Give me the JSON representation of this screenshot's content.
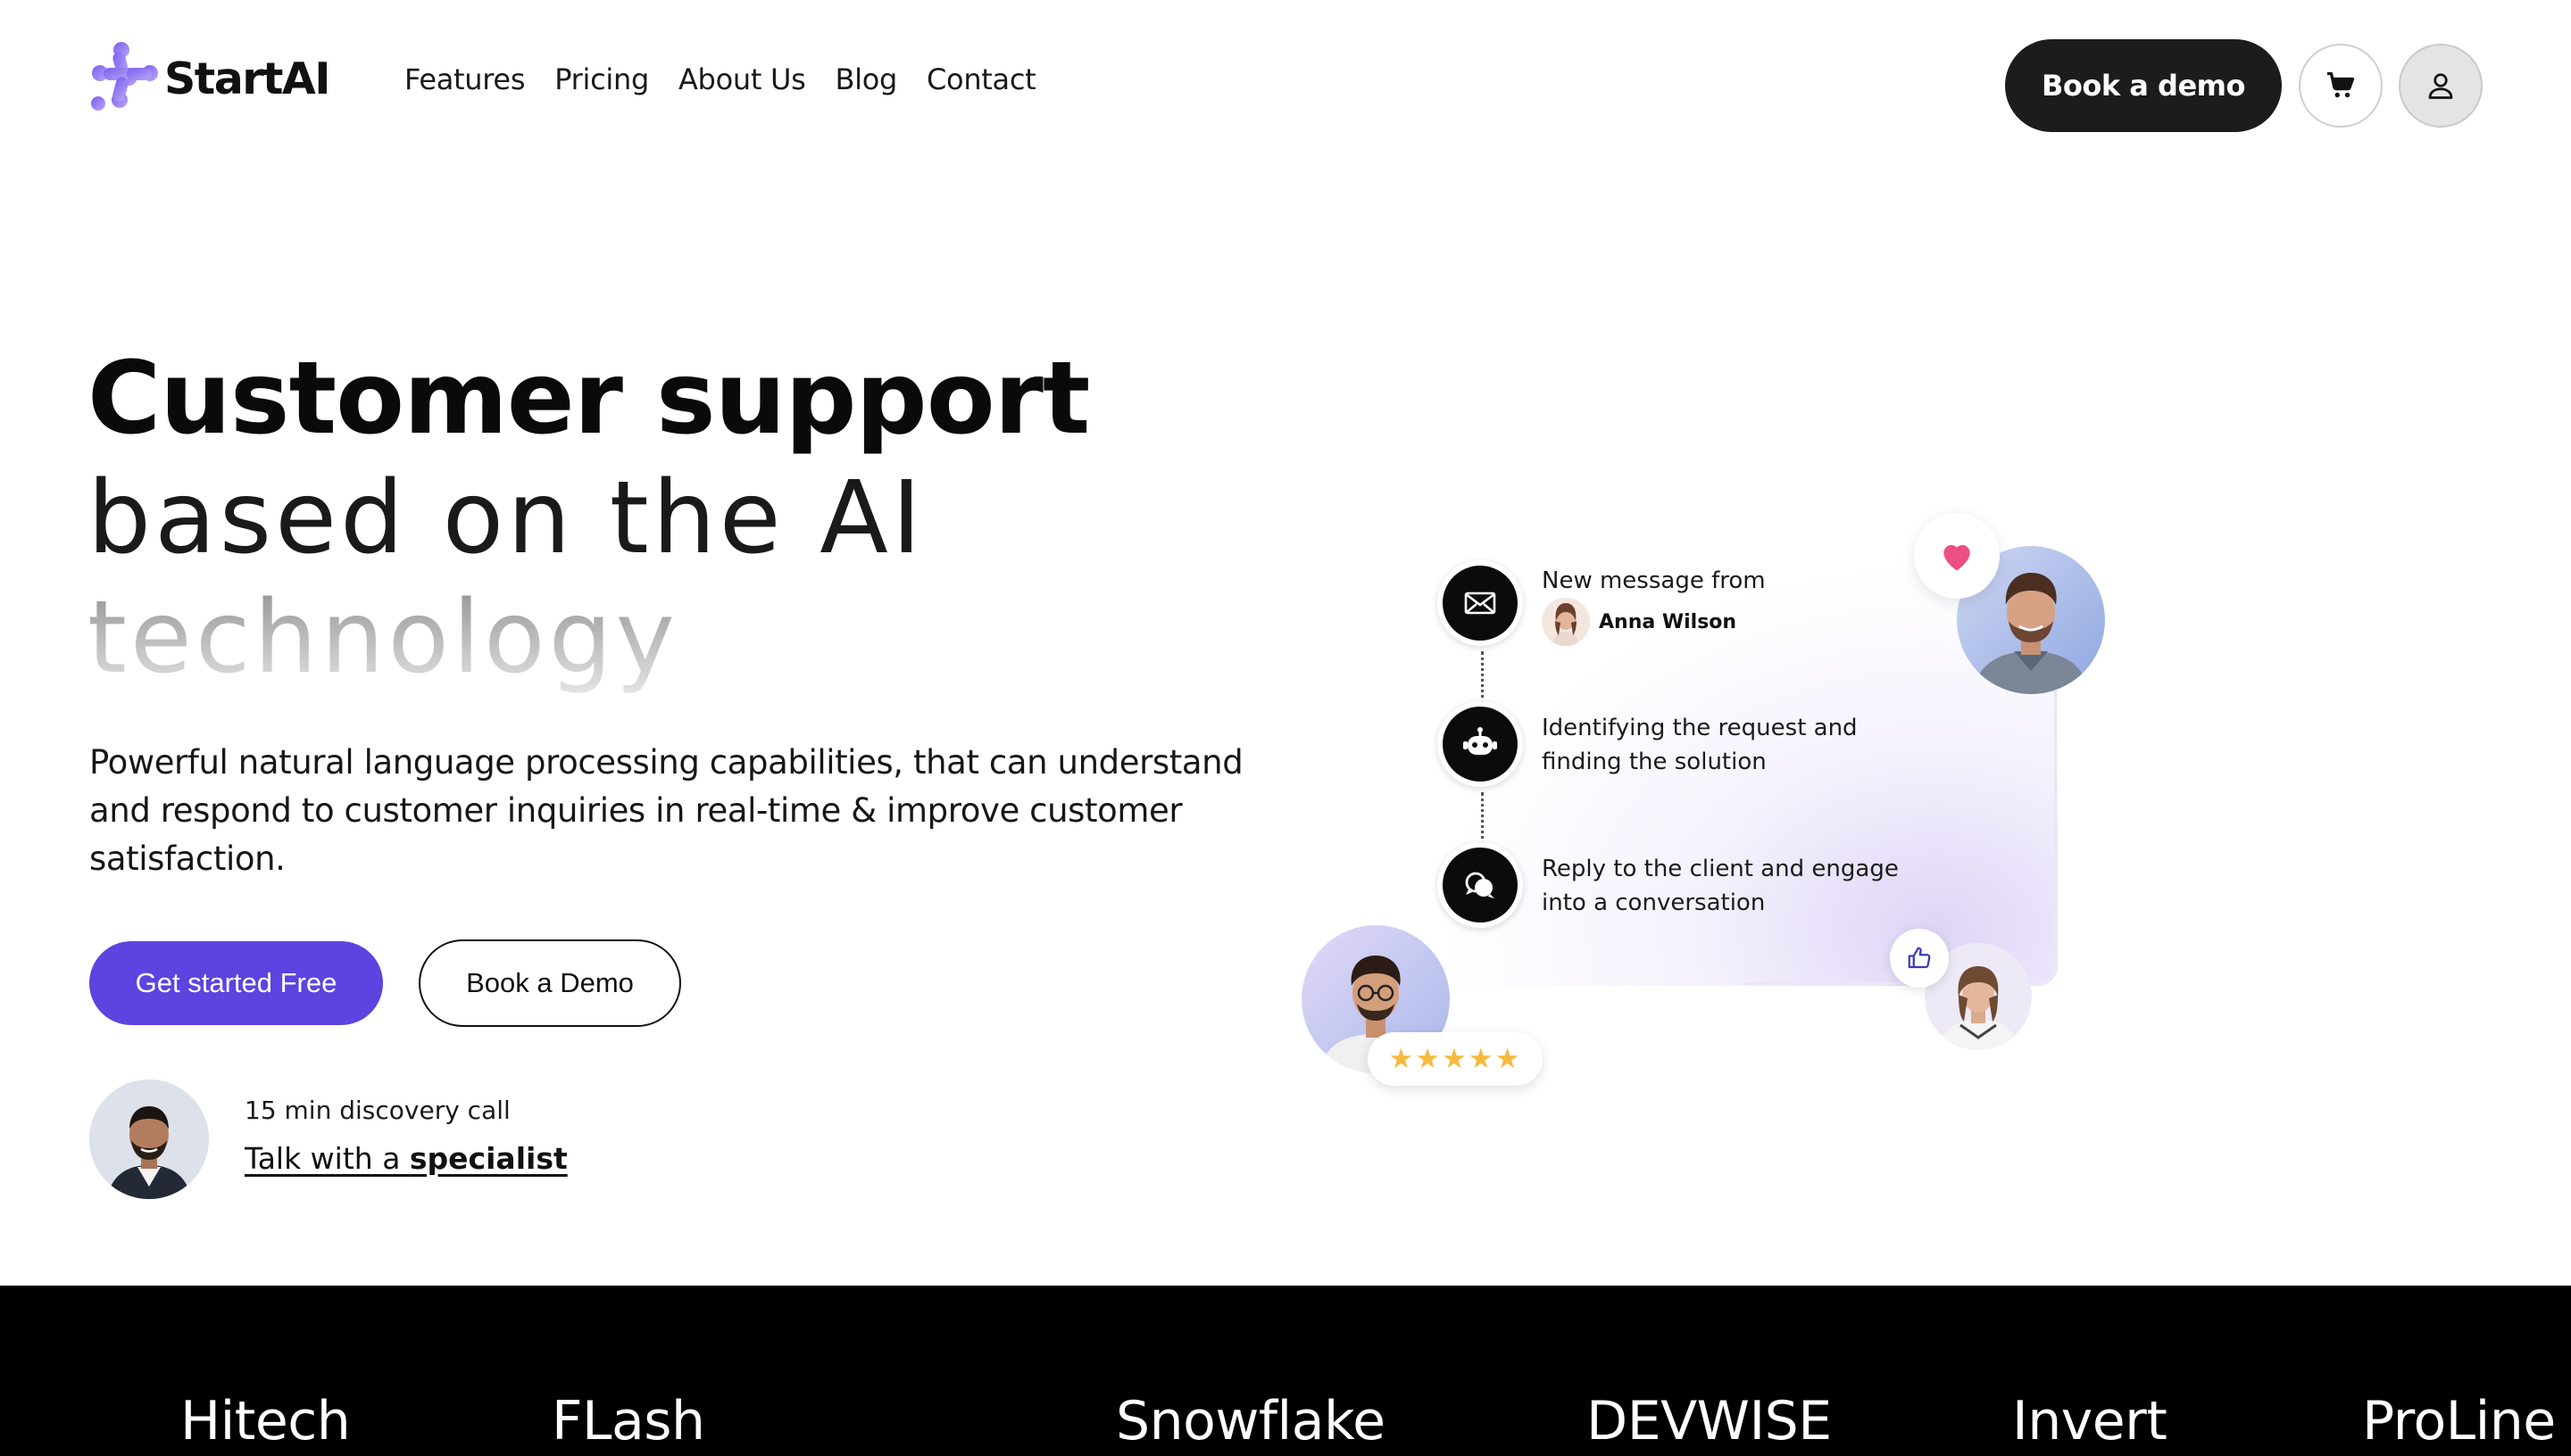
{
  "header": {
    "logo_text": "StartAI",
    "nav": [
      "Features",
      "Pricing",
      "About Us",
      "Blog",
      "Contact"
    ],
    "cta_label": "Book a demo"
  },
  "hero": {
    "title_bold": "Customer support",
    "title_line2": "based on the AI",
    "title_line3": "technology",
    "lead": "Powerful natural language processing capabilities, that can understand and respond to customer inquiries in real-time & improve customer satisfaction.",
    "primary_button": "Get started Free",
    "secondary_button": "Book a Demo",
    "call_label": "15 min discovery call",
    "talk_prefix": "Talk with a ",
    "talk_link": "specialist"
  },
  "illustration": {
    "steps": [
      {
        "text": "New message from",
        "icon": "envelope-icon"
      },
      {
        "text": "Identifying the request and\nfinding the solution",
        "icon": "robot-icon"
      },
      {
        "text": "Reply to the client and engage\ninto a conversation",
        "icon": "chat-bubbles-icon"
      }
    ],
    "sender_name": "Anna Wilson",
    "rating_stars": "★★★★★",
    "rating_value": 5,
    "colors": {
      "heart": "#ec4f82",
      "star": "#f6b93b",
      "accent": "#5d43e0"
    }
  },
  "brands": [
    "Hitech",
    "FLash",
    "Snowflake",
    "DEVWISE",
    "Invert",
    "ProLine"
  ]
}
